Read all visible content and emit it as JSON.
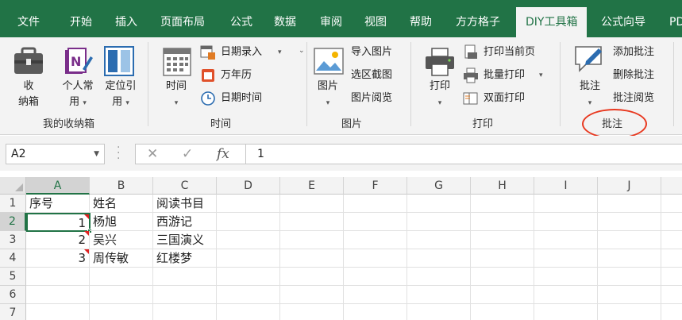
{
  "tabs": [
    {
      "label": "文件",
      "active": false
    },
    {
      "label": "开始",
      "active": false
    },
    {
      "label": "插入",
      "active": false
    },
    {
      "label": "页面布局",
      "active": false
    },
    {
      "label": "公式",
      "active": false
    },
    {
      "label": "数据",
      "active": false
    },
    {
      "label": "审阅",
      "active": false
    },
    {
      "label": "视图",
      "active": false
    },
    {
      "label": "帮助",
      "active": false
    },
    {
      "label": "方方格子",
      "active": false
    },
    {
      "label": "DIY工具箱",
      "active": true
    },
    {
      "label": "公式向导",
      "active": false
    },
    {
      "label": "PD",
      "active": false
    }
  ],
  "ribbon": {
    "collection": {
      "label": "我的收纳箱",
      "shoucang": "收\n纳箱",
      "personal": "个人常",
      "personal2": "用",
      "locate": "定位引",
      "locate2": "用"
    },
    "time": {
      "label": "时间",
      "big": "时间",
      "date_input": "日期录入",
      "calendar": "万年历",
      "datetime": "日期时间"
    },
    "picture": {
      "label": "图片",
      "big": "图片",
      "import": "导入图片",
      "screenshot": "选区截图",
      "browse": "图片阅览"
    },
    "print": {
      "label": "打印",
      "big": "打印",
      "current_page": "打印当前页",
      "batch": "批量打印",
      "duplex": "双面打印"
    },
    "comment": {
      "label": "批注",
      "big": "批注",
      "add": "添加批注",
      "delete": "删除批注",
      "browse": "批注阅览"
    }
  },
  "formula_bar": {
    "name_box": "A2",
    "cancel": "✕",
    "confirm": "✓",
    "fx": "fx",
    "value": "1"
  },
  "sheet": {
    "columns": [
      "A",
      "B",
      "C",
      "D",
      "E",
      "F",
      "G",
      "H",
      "I",
      "J"
    ],
    "rows": [
      "1",
      "2",
      "3",
      "4",
      "5",
      "6",
      "7"
    ],
    "cells": {
      "A1": "序号",
      "B1": "姓名",
      "C1": "阅读书目",
      "A2": "1",
      "B2": "杨旭",
      "C2": "西游记",
      "A3": "2",
      "B3": "吴兴",
      "C3": "三国演义",
      "A4": "3",
      "B4": "周传敏",
      "C4": "红楼梦"
    },
    "active_cell": "A2"
  },
  "colors": {
    "accent": "#217346",
    "annotation": "#e8381f",
    "comment_marker": "#e02020"
  }
}
